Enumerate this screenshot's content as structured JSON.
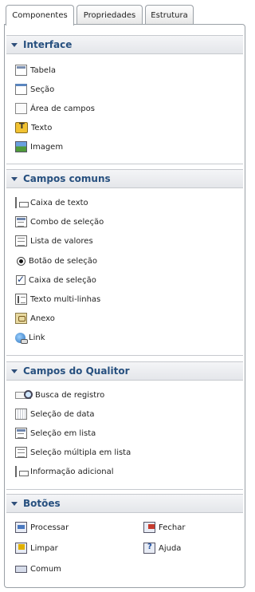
{
  "tabs": [
    {
      "label": "Componentes",
      "active": true
    },
    {
      "label": "Propriedades",
      "active": false
    },
    {
      "label": "Estrutura",
      "active": false
    }
  ],
  "sections": {
    "interface": {
      "title": "Interface",
      "items": [
        {
          "label": "Tabela",
          "icon": "table-icon"
        },
        {
          "label": "Seção",
          "icon": "section-icon"
        },
        {
          "label": "Área de campos",
          "icon": "field-area-icon"
        },
        {
          "label": "Texto",
          "icon": "text-icon"
        },
        {
          "label": "Imagem",
          "icon": "image-icon"
        }
      ]
    },
    "campos_comuns": {
      "title": "Campos comuns",
      "items": [
        {
          "label": "Caixa de texto",
          "icon": "textbox-icon"
        },
        {
          "label": "Combo de seleção",
          "icon": "combo-icon"
        },
        {
          "label": "Lista de valores",
          "icon": "list-icon"
        },
        {
          "label": "Botão de seleção",
          "icon": "radio-icon"
        },
        {
          "label": "Caixa de seleção",
          "icon": "checkbox-icon"
        },
        {
          "label": "Texto multi-linhas",
          "icon": "multiline-icon"
        },
        {
          "label": "Anexo",
          "icon": "attachment-icon"
        },
        {
          "label": "Link",
          "icon": "link-icon"
        }
      ]
    },
    "campos_qualitor": {
      "title": "Campos do Qualitor",
      "items": [
        {
          "label": "Busca de registro",
          "icon": "search-icon"
        },
        {
          "label": "Seleção de data",
          "icon": "date-icon"
        },
        {
          "label": "Seleção em lista",
          "icon": "list-select-icon"
        },
        {
          "label": "Seleção múltipla em lista",
          "icon": "multi-list-icon"
        },
        {
          "label": "Informação adicional",
          "icon": "info-icon"
        }
      ]
    },
    "botoes": {
      "title": "Botões",
      "items": [
        {
          "label": "Processar",
          "icon": "process-icon"
        },
        {
          "label": "Fechar",
          "icon": "close-icon"
        },
        {
          "label": "Limpar",
          "icon": "clear-icon"
        },
        {
          "label": "Ajuda",
          "icon": "help-icon"
        },
        {
          "label": "Comum",
          "icon": "common-button-icon"
        }
      ]
    }
  },
  "colors": {
    "section_title": "#27507f",
    "panel_border": "#9aa0a6"
  }
}
